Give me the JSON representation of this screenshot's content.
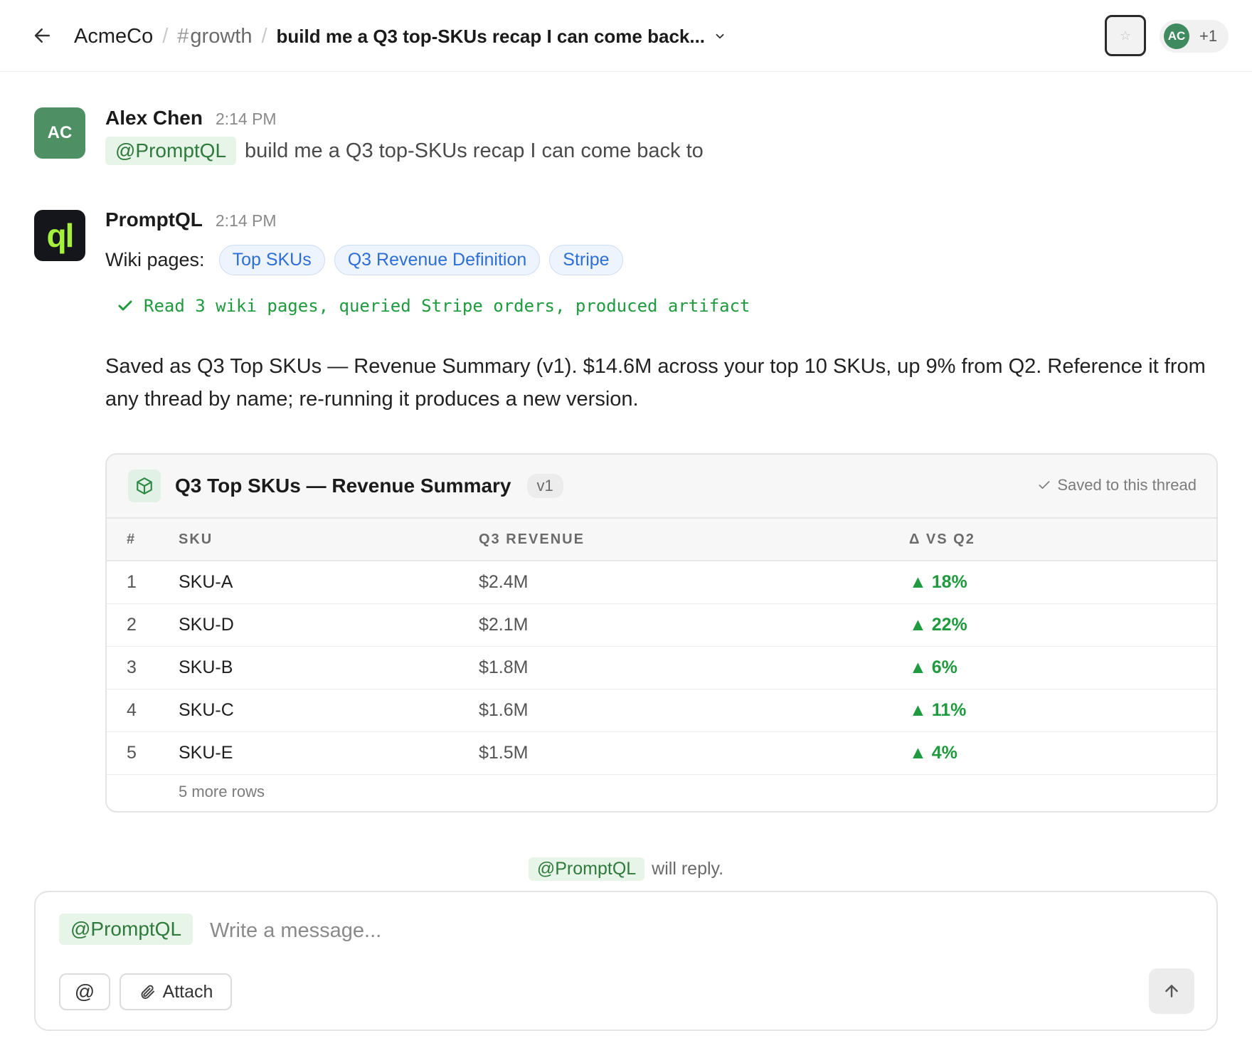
{
  "header": {
    "org": "AcmeCo",
    "separator": "/",
    "channel_hash": "#",
    "channel": "growth",
    "thread_title": "build me a Q3 top-SKUs recap I can come back...",
    "star_icon": "☆",
    "member_initials": "AC",
    "member_extra": "+1"
  },
  "messages": [
    {
      "author": "Alex Chen",
      "time": "2:14 PM",
      "avatar_initials": "AC",
      "mention": "@PromptQL",
      "text": "build me a Q3 top-SKUs recap I can come back to"
    },
    {
      "author": "PromptQL",
      "time": "2:14 PM",
      "avatar_text": "ql",
      "wiki_label": "Wiki pages:",
      "wiki_pages": [
        "Top SKUs",
        "Q3 Revenue Definition",
        "Stripe"
      ],
      "status": "Read 3 wiki pages, queried Stripe orders, produced artifact",
      "summary": "Saved as Q3 Top SKUs — Revenue Summary (v1). $14.6M across your top 10 SKUs, up 9% from Q2. Reference it from any thread by name; re-running it produces a new version."
    }
  ],
  "artifact": {
    "title": "Q3 Top SKUs — Revenue Summary",
    "version": "v1",
    "saved_label": "Saved to this thread",
    "columns": [
      "#",
      "SKU",
      "Q3 REVENUE",
      "Δ VS Q2"
    ],
    "rows": [
      {
        "num": "1",
        "sku": "SKU-A",
        "revenue": "$2.4M",
        "delta": "▲ 18%"
      },
      {
        "num": "2",
        "sku": "SKU-D",
        "revenue": "$2.1M",
        "delta": "▲ 22%"
      },
      {
        "num": "3",
        "sku": "SKU-B",
        "revenue": "$1.8M",
        "delta": "▲ 6%"
      },
      {
        "num": "4",
        "sku": "SKU-C",
        "revenue": "$1.6M",
        "delta": "▲ 11%"
      },
      {
        "num": "5",
        "sku": "SKU-E",
        "revenue": "$1.5M",
        "delta": "▲ 4%"
      }
    ],
    "more_rows": "5 more rows"
  },
  "reply_hint": {
    "mention": "@PromptQL",
    "text": "will reply."
  },
  "composer": {
    "mention": "@PromptQL",
    "placeholder": "Write a message...",
    "at_label": "@",
    "attach_label": "Attach"
  },
  "colors": {
    "accent_green": "#1f9a3e",
    "mention_bg": "#e7f4e8",
    "wiki_blue": "#2d6fd6",
    "avatar_green": "#4e8f63",
    "ql_bg": "#15151c",
    "ql_fg": "#a5f03c"
  }
}
